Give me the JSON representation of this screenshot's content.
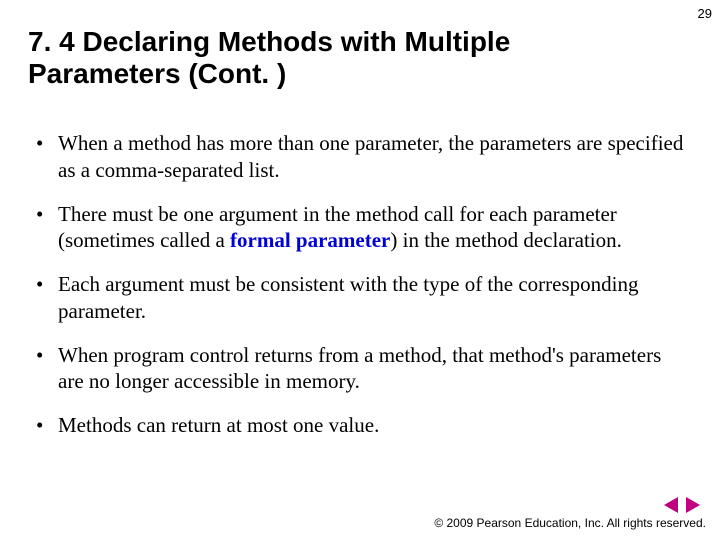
{
  "page_number": "29",
  "title": "7. 4  Declaring Methods with Multiple Parameters (Cont. )",
  "bullets": [
    {
      "text": "When a method has more than one parameter, the parameters are specified as a comma-separated list."
    },
    {
      "pre": "There must be one argument in the method call for each parameter (sometimes called a ",
      "formal": "formal parameter",
      "post": ") in the method declaration."
    },
    {
      "text": "Each argument must be consistent with the type of the corresponding parameter."
    },
    {
      "text": "When program control returns from a method, that method's parameters are no longer accessible in memory."
    },
    {
      "text": "Methods can return at most one value."
    }
  ],
  "copyright": "© 2009 Pearson Education, Inc.  All rights reserved.",
  "nav": {
    "prev": "previous-slide",
    "next": "next-slide"
  }
}
